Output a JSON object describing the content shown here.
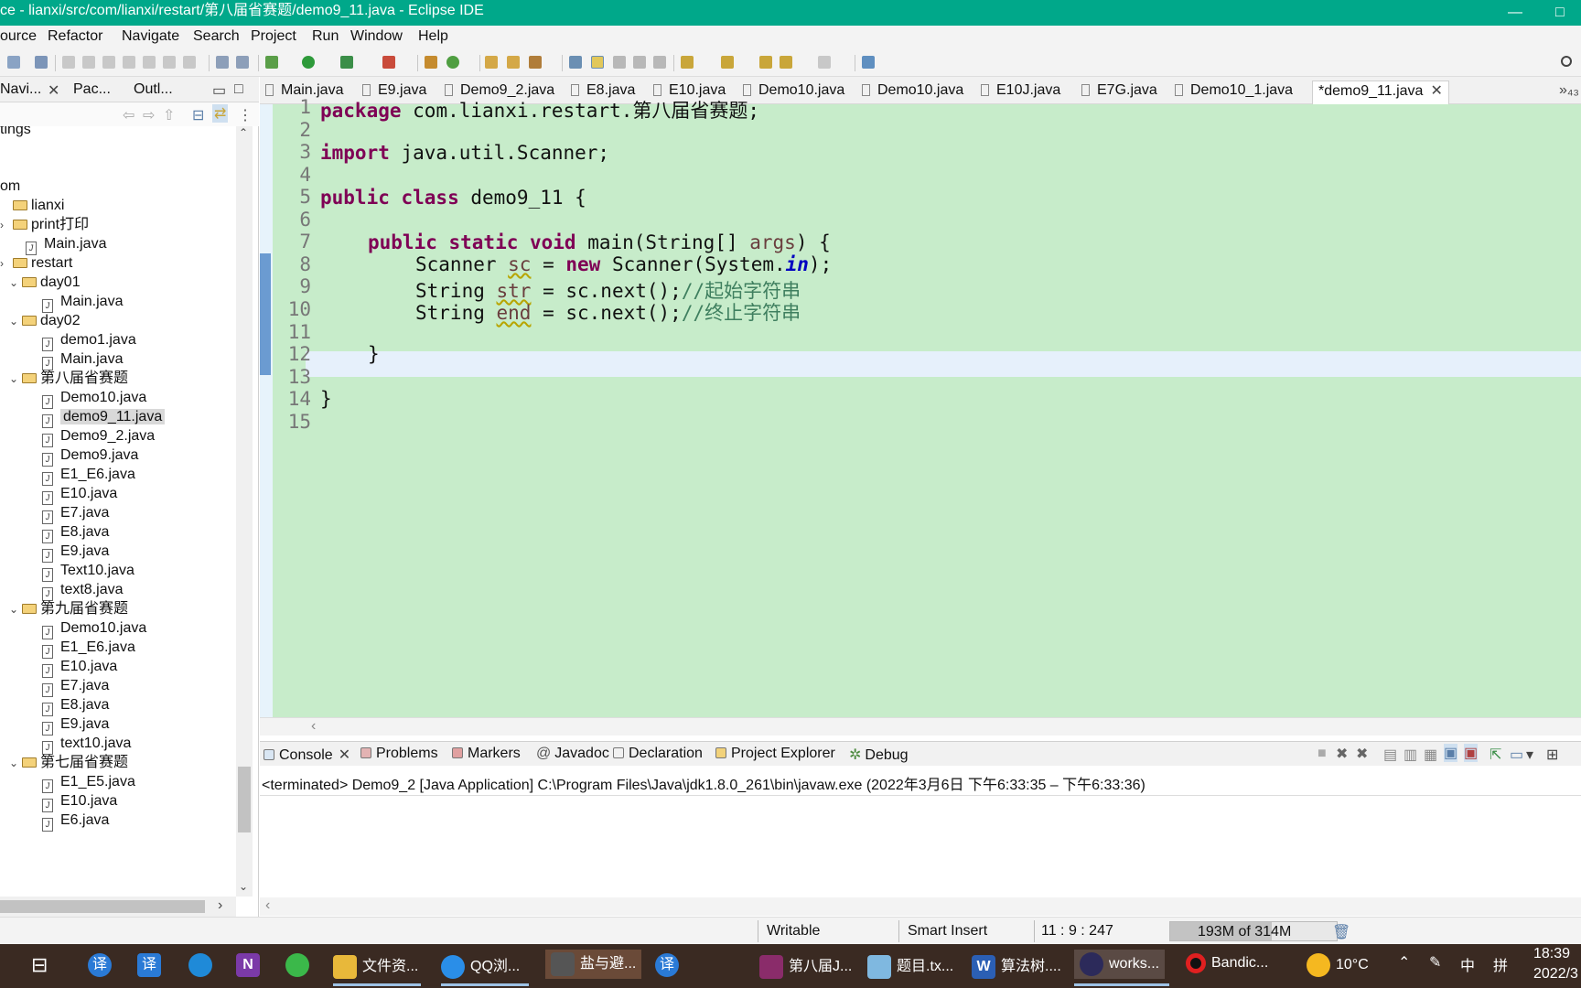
{
  "window": {
    "title": "ce - lianxi/src/com/lianxi/restart/第八届省赛题/demo9_11.java - Eclipse IDE",
    "controls": [
      "—",
      "□"
    ]
  },
  "menu": [
    "ource",
    "Refactor",
    "Navigate",
    "Search",
    "Project",
    "Run",
    "Window",
    "Help"
  ],
  "left_tabs": [
    "Navi...",
    "Pac...",
    "Outl..."
  ],
  "tree": [
    {
      "label": "tings",
      "depth": 0,
      "kind": "text",
      "chev": ""
    },
    {
      "label": "om",
      "depth": 0,
      "kind": "text",
      "chev": ""
    },
    {
      "label": "lianxi",
      "depth": 0,
      "kind": "folder",
      "chev": ""
    },
    {
      "label": "print打印",
      "depth": 1,
      "kind": "folder",
      "chev": "›"
    },
    {
      "label": "Main.java",
      "depth": 2,
      "kind": "java",
      "chev": ""
    },
    {
      "label": "restart",
      "depth": 1,
      "kind": "folder",
      "chev": "›"
    },
    {
      "label": "day01",
      "depth": 2,
      "kind": "folder",
      "chev": "⌄"
    },
    {
      "label": "Main.java",
      "depth": 3,
      "kind": "java",
      "chev": ""
    },
    {
      "label": "day02",
      "depth": 2,
      "kind": "folder",
      "chev": "⌄"
    },
    {
      "label": "demo1.java",
      "depth": 3,
      "kind": "java",
      "chev": ""
    },
    {
      "label": "Main.java",
      "depth": 3,
      "kind": "java",
      "chev": ""
    },
    {
      "label": "第八届省赛题",
      "depth": 2,
      "kind": "folder",
      "chev": "⌄"
    },
    {
      "label": "Demo10.java",
      "depth": 3,
      "kind": "java",
      "chev": ""
    },
    {
      "label": "demo9_11.java",
      "depth": 3,
      "kind": "java",
      "chev": "",
      "selected": true
    },
    {
      "label": "Demo9_2.java",
      "depth": 3,
      "kind": "java",
      "chev": ""
    },
    {
      "label": "Demo9.java",
      "depth": 3,
      "kind": "java",
      "chev": ""
    },
    {
      "label": "E1_E6.java",
      "depth": 3,
      "kind": "java",
      "chev": ""
    },
    {
      "label": "E10.java",
      "depth": 3,
      "kind": "java",
      "chev": ""
    },
    {
      "label": "E7.java",
      "depth": 3,
      "kind": "java",
      "chev": ""
    },
    {
      "label": "E8.java",
      "depth": 3,
      "kind": "java",
      "chev": ""
    },
    {
      "label": "E9.java",
      "depth": 3,
      "kind": "java",
      "chev": ""
    },
    {
      "label": "Text10.java",
      "depth": 3,
      "kind": "java",
      "chev": ""
    },
    {
      "label": "text8.java",
      "depth": 3,
      "kind": "java",
      "chev": ""
    },
    {
      "label": "第九届省赛题",
      "depth": 2,
      "kind": "folder",
      "chev": "⌄"
    },
    {
      "label": "Demo10.java",
      "depth": 3,
      "kind": "java",
      "chev": ""
    },
    {
      "label": "E1_E6.java",
      "depth": 3,
      "kind": "java",
      "chev": ""
    },
    {
      "label": "E10.java",
      "depth": 3,
      "kind": "java",
      "chev": ""
    },
    {
      "label": "E7.java",
      "depth": 3,
      "kind": "java",
      "chev": ""
    },
    {
      "label": "E8.java",
      "depth": 3,
      "kind": "java",
      "chev": ""
    },
    {
      "label": "E9.java",
      "depth": 3,
      "kind": "java",
      "chev": ""
    },
    {
      "label": "text10.java",
      "depth": 3,
      "kind": "java",
      "chev": ""
    },
    {
      "label": "第七届省赛题",
      "depth": 2,
      "kind": "folder",
      "chev": "⌄"
    },
    {
      "label": "E1_E5.java",
      "depth": 3,
      "kind": "java",
      "chev": ""
    },
    {
      "label": "E10.java",
      "depth": 3,
      "kind": "java",
      "chev": ""
    },
    {
      "label": "E6.java",
      "depth": 3,
      "kind": "java",
      "chev": ""
    }
  ],
  "editor_tabs": [
    "Main.java",
    "E9.java",
    "Demo9_2.java",
    "E8.java",
    "E10.java",
    "Demo10.java",
    "Demo10.java",
    "E10J.java",
    "E7G.java",
    "Demo10_1.java",
    "*demo9_11.java"
  ],
  "editor_overflow": "»₄₃",
  "code": {
    "line_numbers": [
      "1",
      "2",
      "3",
      "4",
      "5",
      "6",
      "7",
      "8",
      "9",
      "10",
      "11",
      "12",
      "13",
      "14",
      "15"
    ],
    "l1_kw": "package",
    "l1_rest": " com.lianxi.restart.第八届省赛题;",
    "l3_kw": "import",
    "l3_rest": " java.util.Scanner;",
    "l5_kw": "public class",
    "l5_rest": " demo9_11 {",
    "l7_kw": "public static void",
    "l7_a": " main(String[] ",
    "l7_var": "args",
    "l7_b": ") {",
    "l8_a": "Scanner ",
    "l8_var": "sc",
    "l8_b": " = ",
    "l8_kw": "new",
    "l8_c": " Scanner(System.",
    "l8_fld": "in",
    "l8_d": ");",
    "l9_a": "String ",
    "l9_var": "str",
    "l9_b": " = sc.next();",
    "l9_cm": "//起始字符串",
    "l10_a": "String ",
    "l10_var": "end",
    "l10_b": " = sc.next();",
    "l10_cm": "//终止字符串",
    "l12": "}",
    "l14": "}"
  },
  "bottom_tabs": [
    "Console",
    "Problems",
    "Markers",
    "Javadoc",
    "Declaration",
    "Project Explorer",
    "Debug"
  ],
  "console_text": "<terminated> Demo9_2 [Java Application] C:\\Program Files\\Java\\jdk1.8.0_261\\bin\\javaw.exe  (2022年3月6日 下午6:33:35 – 下午6:33:36)",
  "status": {
    "writable": "Writable",
    "insert": "Smart Insert",
    "position": "11 : 9 : 247",
    "heap": "193M of 314M",
    "heap_fraction": 0.61
  },
  "taskbar": [
    {
      "label": "",
      "icon": "task-view-icon"
    },
    {
      "label": "",
      "icon": "translate-icon"
    },
    {
      "label": "",
      "icon": "translate-icon-2"
    },
    {
      "label": "",
      "icon": "edge-icon"
    },
    {
      "label": "",
      "icon": "onenote-icon"
    },
    {
      "label": "",
      "icon": "wechat-icon"
    },
    {
      "label": "文件资...",
      "icon": "file-explorer-icon"
    },
    {
      "label": "QQ浏...",
      "icon": "qq-browser-icon"
    },
    {
      "label": "盐与避...",
      "icon": "game-icon"
    },
    {
      "label": "",
      "icon": "translate-icon-3"
    },
    {
      "label": "第八届J...",
      "icon": "winrar-icon"
    },
    {
      "label": "题目.tx...",
      "icon": "notepad-icon"
    },
    {
      "label": "算法树....",
      "icon": "word-icon"
    },
    {
      "label": "works...",
      "icon": "eclipse-icon"
    },
    {
      "label": "Bandic...",
      "icon": "bandicam-icon"
    }
  ],
  "tray": {
    "temp": "10°C",
    "ime1": "中",
    "ime2": "拼",
    "time": "18:39",
    "date": "2022/3"
  },
  "colors": {
    "titlebar": "#00a88a",
    "editor_bg": "#c7ecca",
    "keyword": "#7f0055",
    "comment": "#3f7f5f"
  }
}
